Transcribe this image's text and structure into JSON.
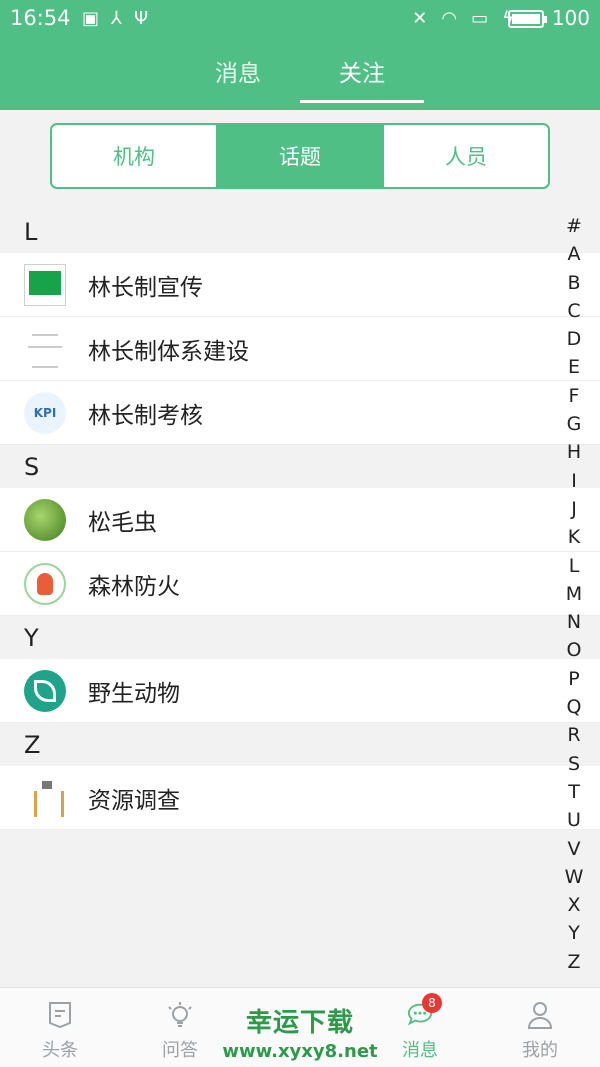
{
  "statusbar": {
    "time": "16:54",
    "battery_level": "100",
    "icons_left": [
      "news-app-icon",
      "share-icon",
      "usb-icon"
    ],
    "icons_right": [
      "mute-icon",
      "wifi-icon",
      "screen-icon",
      "charging-icon"
    ]
  },
  "header": {
    "tabs": [
      {
        "label": "消息"
      },
      {
        "label": "关注"
      }
    ],
    "active_tab": "关注"
  },
  "segment": {
    "items": [
      {
        "label": "机构"
      },
      {
        "label": "话题"
      },
      {
        "label": "人员"
      }
    ],
    "active": "话题"
  },
  "sections": [
    {
      "letter": "L",
      "items": [
        {
          "label": "林长制宣传",
          "thumb": "green-board"
        },
        {
          "label": "林长制体系建设",
          "thumb": "diagram"
        },
        {
          "label": "林长制考核",
          "thumb": "kpi"
        }
      ]
    },
    {
      "letter": "S",
      "items": [
        {
          "label": "松毛虫",
          "thumb": "caterpillar"
        },
        {
          "label": "森林防火",
          "thumb": "fire"
        }
      ]
    },
    {
      "letter": "Y",
      "items": [
        {
          "label": "野生动物",
          "thumb": "wildlife"
        }
      ]
    },
    {
      "letter": "Z",
      "items": [
        {
          "label": "资源调查",
          "thumb": "survey"
        }
      ]
    }
  ],
  "thumb_text": {
    "kpi": "KPI"
  },
  "index_bar": [
    "#",
    "A",
    "B",
    "C",
    "D",
    "E",
    "F",
    "G",
    "H",
    "I",
    "J",
    "K",
    "L",
    "M",
    "N",
    "O",
    "P",
    "Q",
    "R",
    "S",
    "T",
    "U",
    "V",
    "W",
    "X",
    "Y",
    "Z"
  ],
  "bottom_nav": [
    {
      "label": "头条",
      "icon": "headline-icon"
    },
    {
      "label": "问答",
      "icon": "lightbulb-icon"
    },
    {
      "label": "",
      "icon": "center-icon"
    },
    {
      "label": "消息",
      "icon": "chat-icon",
      "badge": "8"
    },
    {
      "label": "我的",
      "icon": "person-icon"
    }
  ],
  "watermark": {
    "title": "幸运下载",
    "url": "www.xyxy8.net"
  },
  "colors": {
    "accent": "#4fbf85",
    "badge": "#e53935"
  }
}
